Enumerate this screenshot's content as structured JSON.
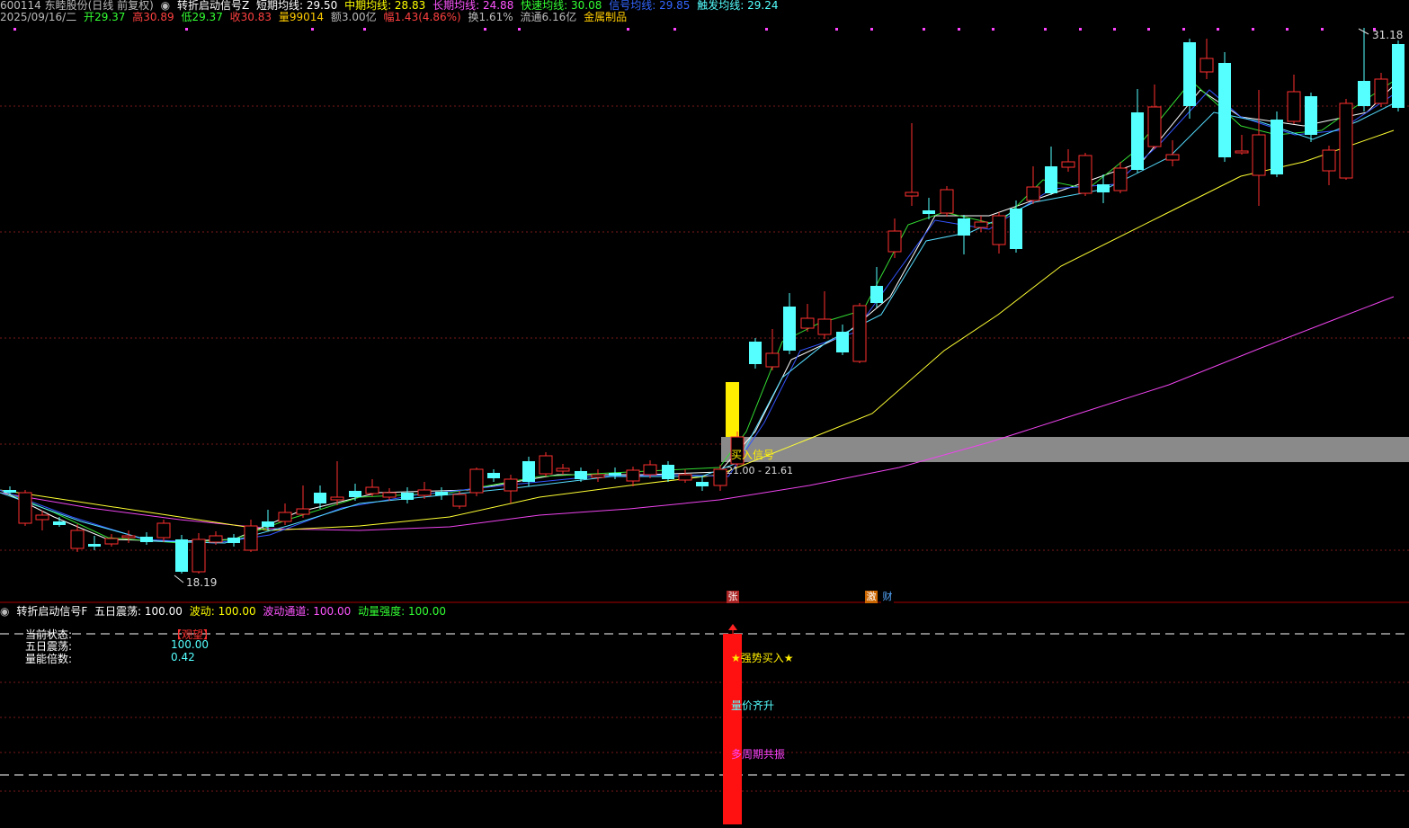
{
  "header": {
    "code_name": "600114 东睦股份(日线 前复权)",
    "indicator_name": "转折启动信号Z",
    "ma_short_label": "短期均线: ",
    "ma_short_value": "29.50",
    "ma_mid_label": "中期均线: ",
    "ma_mid_value": "28.83",
    "ma_long_label": "长期均线: ",
    "ma_long_value": "24.88",
    "ma_fast_label": "快速均线: ",
    "ma_fast_value": "30.08",
    "ma_signal_label": "信号均线: ",
    "ma_signal_value": "29.85",
    "ma_trigger_label": "触发均线: ",
    "ma_trigger_value": "29.24"
  },
  "quote": {
    "date": "2025/09/16/二",
    "open_label": "开",
    "open": "29.37",
    "high_label": "高",
    "high": "30.89",
    "low_label": "低",
    "low": "29.37",
    "close_label": "收",
    "close": "30.83",
    "volume_label": "量",
    "volume": "99014",
    "amount_label": "额",
    "amount": "3.00亿",
    "change_label": "幅",
    "change": "1.43(4.86%)",
    "turnover_label": "换",
    "turnover": "1.61%",
    "float_label": "流通",
    "float": "6.16亿",
    "sector": "金属制品"
  },
  "price_labels": {
    "high_marker": "31.18",
    "low_marker": "18.19",
    "signal_range": "21.00 - 21.61",
    "buy_signal": "买入信号"
  },
  "event_badges": {
    "zhang": "张",
    "ji": "激",
    "cai": "财"
  },
  "sub_header": {
    "name": "转折启动信号F",
    "shock_label": "五日震荡: ",
    "shock_value": "100.00",
    "wave_label": "波动: ",
    "wave_value": "100.00",
    "channel_label": "波动通道: ",
    "channel_value": "100.00",
    "momentum_label": "动量强度: ",
    "momentum_value": "100.00"
  },
  "status_panel": {
    "state_label": "当前状态:",
    "state_value": "【观望】",
    "shock_label": "五日震荡:",
    "shock_value": "100.00",
    "ratio_label": "量能倍数:",
    "ratio_value": "0.42"
  },
  "signal_texts": {
    "strong_buy": "★强势买入★",
    "vol_price": "量价齐升",
    "multi_cycle": "多周期共振"
  },
  "colors": {
    "up": "#ff3030",
    "down": "#55ffff",
    "ma_yellow": "#ffff33",
    "ma_magenta": "#ee44ee",
    "ma_white": "#ffffff",
    "ma_green": "#33dd33",
    "ma_blue": "#3355ff",
    "ma_cyan": "#55ddff"
  }
}
